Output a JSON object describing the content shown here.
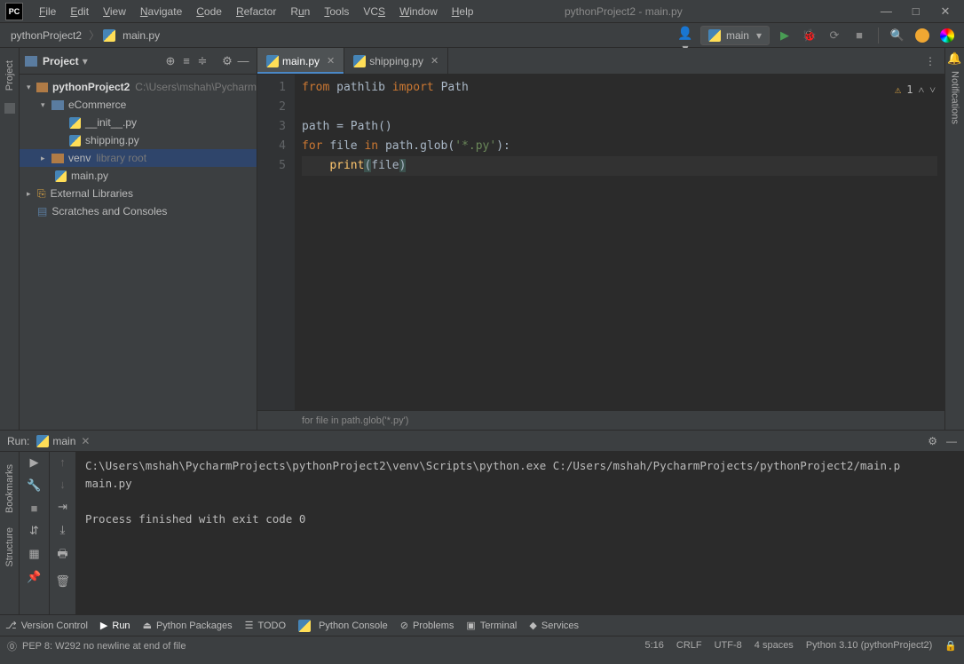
{
  "titlebar": {
    "title": "pythonProject2 - main.py"
  },
  "menu": [
    "File",
    "Edit",
    "View",
    "Navigate",
    "Code",
    "Refactor",
    "Run",
    "Tools",
    "VCS",
    "Window",
    "Help"
  ],
  "breadcrumb": {
    "project": "pythonProject2",
    "file": "main.py"
  },
  "runconfig": {
    "label": "main"
  },
  "project_tool": {
    "title": "Project",
    "root": {
      "name": "pythonProject2",
      "path": "C:\\Users\\mshah\\Pycharm"
    },
    "ecommerce": {
      "name": "eCommerce",
      "init": "__init__.py",
      "shipping": "shipping.py"
    },
    "venv": {
      "name": "venv",
      "hint": "library root"
    },
    "mainfile": "main.py",
    "external": "External Libraries",
    "scratches": "Scratches and Consoles"
  },
  "tabs": [
    {
      "label": "main.py",
      "active": true
    },
    {
      "label": "shipping.py",
      "active": false
    }
  ],
  "code": {
    "lines": [
      "1",
      "2",
      "3",
      "4",
      "5"
    ],
    "line1": {
      "kw1": "from ",
      "mod": "pathlib ",
      "kw2": "import ",
      "cls": "Path"
    },
    "line3": {
      "text": "path = Path()"
    },
    "line4": {
      "kw1": "for ",
      "v": "file ",
      "kw2": "in ",
      "call": "path.glob(",
      "str": "'*.py'",
      "end": "):"
    },
    "line5": {
      "indent": "    ",
      "fn": "print",
      "open": "(",
      "arg": "file",
      "close": ")"
    },
    "crumb": "for file in path.glob('*.py')"
  },
  "warnings": {
    "count": "1"
  },
  "run": {
    "label": "Run:",
    "config": "main",
    "out1": "C:\\Users\\mshah\\PycharmProjects\\pythonProject2\\venv\\Scripts\\python.exe C:/Users/mshah/PycharmProjects/pythonProject2/main.p",
    "out2": "main.py",
    "exit": "Process finished with exit code 0"
  },
  "left_labels": {
    "project": "Project",
    "bookmarks": "Bookmarks",
    "structure": "Structure"
  },
  "right_label": "Notifications",
  "bottom_tools": {
    "vcs": "Version Control",
    "run": "Run",
    "pkg": "Python Packages",
    "todo": "TODO",
    "console": "Python Console",
    "problems": "Problems",
    "terminal": "Terminal",
    "services": "Services"
  },
  "status": {
    "msg": "PEP 8: W292 no newline at end of file",
    "pos": "5:16",
    "eol": "CRLF",
    "enc": "UTF-8",
    "indent": "4 spaces",
    "interp": "Python 3.10 (pythonProject2)"
  }
}
